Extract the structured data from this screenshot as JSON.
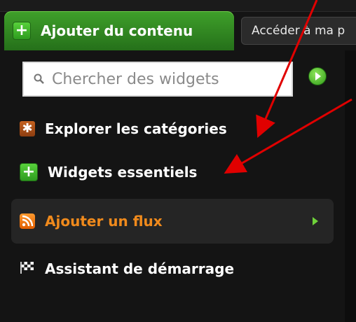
{
  "header": {
    "add_content_label": "Ajouter du contenu",
    "goto_label": "Accéder à ma p"
  },
  "search": {
    "placeholder": "Chercher des widgets"
  },
  "menu": {
    "items": [
      {
        "label": "Explorer les catégories",
        "icon": "asterisk-category-icon"
      },
      {
        "label": "Widgets essentiels",
        "icon": "plus-icon"
      },
      {
        "label": "Ajouter un flux",
        "icon": "rss-feed-icon",
        "active": true
      },
      {
        "label": "Assistant de démarrage",
        "icon": "checkered-flag-icon"
      }
    ]
  },
  "colors": {
    "background": "#141414",
    "tab_green": "#3fa02a",
    "active_orange": "#f08a1c",
    "annotation_red": "#e00000"
  }
}
